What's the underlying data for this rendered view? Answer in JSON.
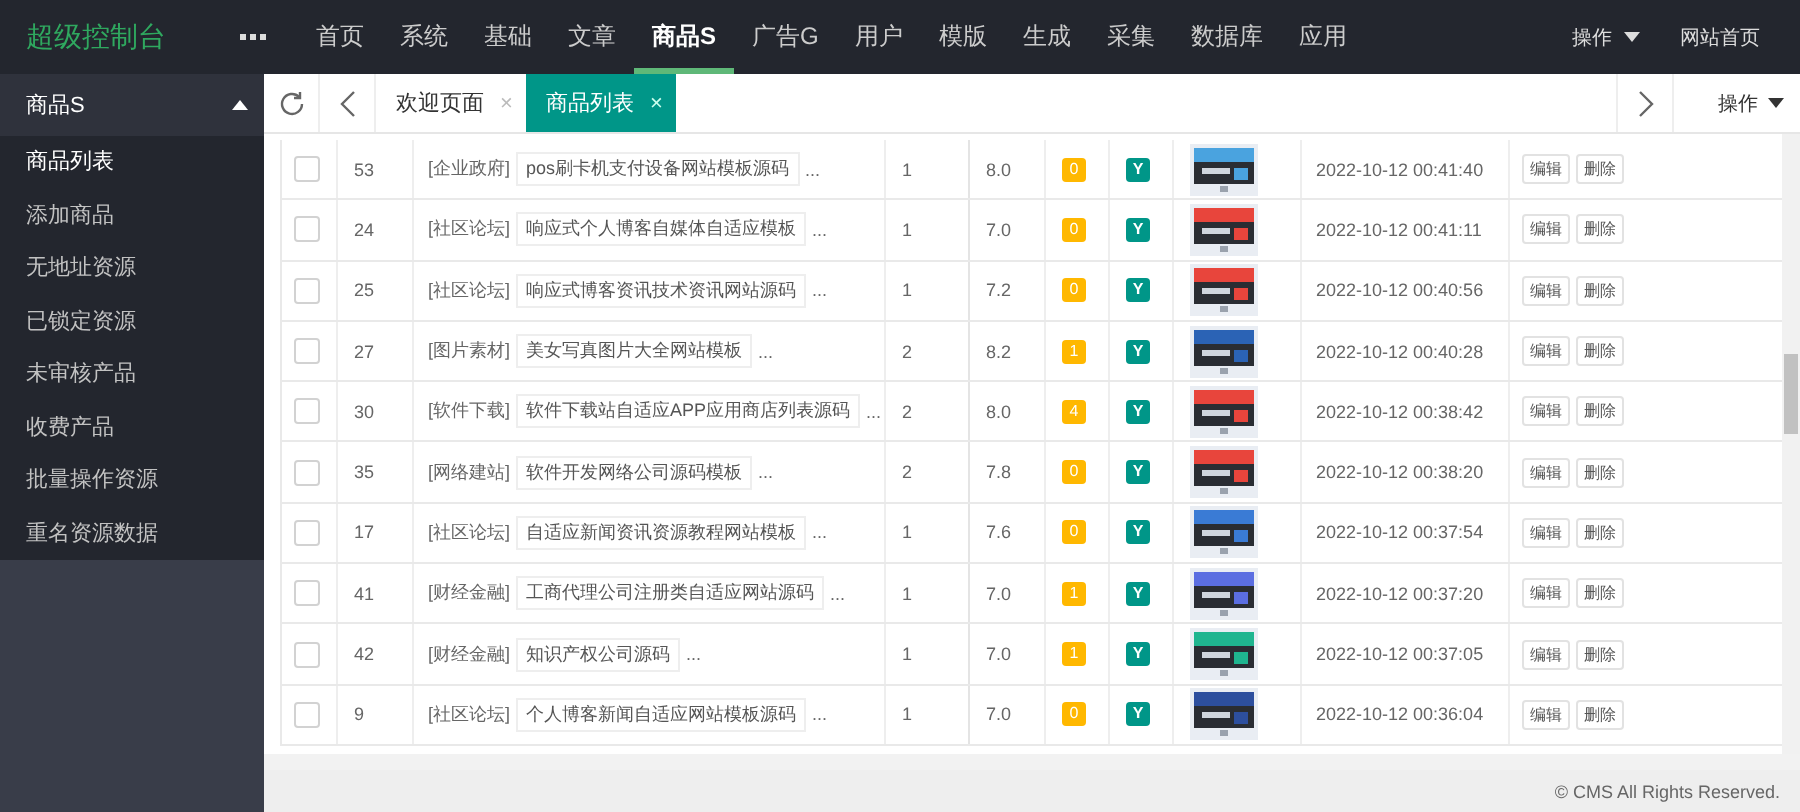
{
  "brand": "超级控制台",
  "nav": [
    {
      "label": "首页",
      "selected": false
    },
    {
      "label": "系统",
      "selected": false
    },
    {
      "label": "基础",
      "selected": false
    },
    {
      "label": "文章",
      "selected": false
    },
    {
      "label": "商品S",
      "selected": true
    },
    {
      "label": "广告G",
      "selected": false
    },
    {
      "label": "用户",
      "selected": false
    },
    {
      "label": "模版",
      "selected": false
    },
    {
      "label": "生成",
      "selected": false
    },
    {
      "label": "采集",
      "selected": false
    },
    {
      "label": "数据库",
      "selected": false
    },
    {
      "label": "应用",
      "selected": false
    }
  ],
  "top_right": {
    "menu": "操作",
    "link": "网站首页"
  },
  "sidebar": {
    "title": "商品S",
    "expanded": true,
    "items": [
      {
        "label": "商品列表",
        "selected": true
      },
      {
        "label": "添加商品",
        "selected": false
      },
      {
        "label": "无地址资源",
        "selected": false
      },
      {
        "label": "已锁定资源",
        "selected": false
      },
      {
        "label": "未审核产品",
        "selected": false
      },
      {
        "label": "收费产品",
        "selected": false
      },
      {
        "label": "批量操作资源",
        "selected": false
      },
      {
        "label": "重名资源数据",
        "selected": false
      }
    ]
  },
  "tabs": [
    {
      "label": "欢迎页面",
      "close": "×",
      "selected": false
    },
    {
      "label": "商品列表",
      "close": "×",
      "selected": true
    }
  ],
  "tab_menu": "操作",
  "rows": [
    {
      "checked": false,
      "id": "53",
      "category": "[企业政府]",
      "title": "pos刷卡机支付设备网站模板源码",
      "more": "...",
      "column_4": "1",
      "score": "8.0",
      "count": "0",
      "flag": "Y",
      "time": "2022-10-12 00:41:40",
      "actions": [
        "编辑",
        "删除"
      ]
    },
    {
      "checked": false,
      "id": "24",
      "category": "[社区论坛]",
      "title": "响应式个人博客自媒体自适应模板",
      "more": "...",
      "column_4": "1",
      "score": "7.0",
      "count": "0",
      "flag": "Y",
      "time": "2022-10-12 00:41:11",
      "actions": [
        "编辑",
        "删除"
      ]
    },
    {
      "checked": false,
      "id": "25",
      "category": "[社区论坛]",
      "title": "响应式博客资讯技术资讯网站源码",
      "more": "...",
      "column_4": "1",
      "score": "7.2",
      "count": "0",
      "flag": "Y",
      "time": "2022-10-12 00:40:56",
      "actions": [
        "编辑",
        "删除"
      ]
    },
    {
      "checked": false,
      "id": "27",
      "category": "[图片素材]",
      "title": "美女写真图片大全网站模板",
      "more": "...",
      "column_4": "2",
      "score": "8.2",
      "count": "1",
      "flag": "Y",
      "time": "2022-10-12 00:40:28",
      "actions": [
        "编辑",
        "删除"
      ]
    },
    {
      "checked": false,
      "id": "30",
      "category": "[软件下载]",
      "title": "软件下载站自适应APP应用商店列表源码",
      "more": "...",
      "column_4": "2",
      "score": "8.0",
      "count": "4",
      "flag": "Y",
      "time": "2022-10-12 00:38:42",
      "actions": [
        "编辑",
        "删除"
      ]
    },
    {
      "checked": false,
      "id": "35",
      "category": "[网络建站]",
      "title": "软件开发网络公司源码模板",
      "more": "...",
      "column_4": "2",
      "score": "7.8",
      "count": "0",
      "flag": "Y",
      "time": "2022-10-12 00:38:20",
      "actions": [
        "编辑",
        "删除"
      ]
    },
    {
      "checked": false,
      "id": "17",
      "category": "[社区论坛]",
      "title": "自适应新闻资讯资源教程网站模板",
      "more": "...",
      "column_4": "1",
      "score": "7.6",
      "count": "0",
      "flag": "Y",
      "time": "2022-10-12 00:37:54",
      "actions": [
        "编辑",
        "删除"
      ]
    },
    {
      "checked": false,
      "id": "41",
      "category": "[财经金融]",
      "title": "工商代理公司注册类自适应网站源码",
      "more": "...",
      "column_4": "1",
      "score": "7.0",
      "count": "1",
      "flag": "Y",
      "time": "2022-10-12 00:37:20",
      "actions": [
        "编辑",
        "删除"
      ]
    },
    {
      "checked": false,
      "id": "42",
      "category": "[财经金融]",
      "title": "知识产权公司源码",
      "more": "...",
      "column_4": "1",
      "score": "7.0",
      "count": "1",
      "flag": "Y",
      "time": "2022-10-12 00:37:05",
      "actions": [
        "编辑",
        "删除"
      ]
    },
    {
      "checked": false,
      "id": "9",
      "category": "[社区论坛]",
      "title": "个人博客新闻自适应网站模板源码",
      "more": "...",
      "column_4": "1",
      "score": "7.0",
      "count": "0",
      "flag": "Y",
      "time": "2022-10-12 00:36:04",
      "actions": [
        "编辑",
        "删除"
      ]
    }
  ],
  "footer": "© CMS All Rights Reserved."
}
